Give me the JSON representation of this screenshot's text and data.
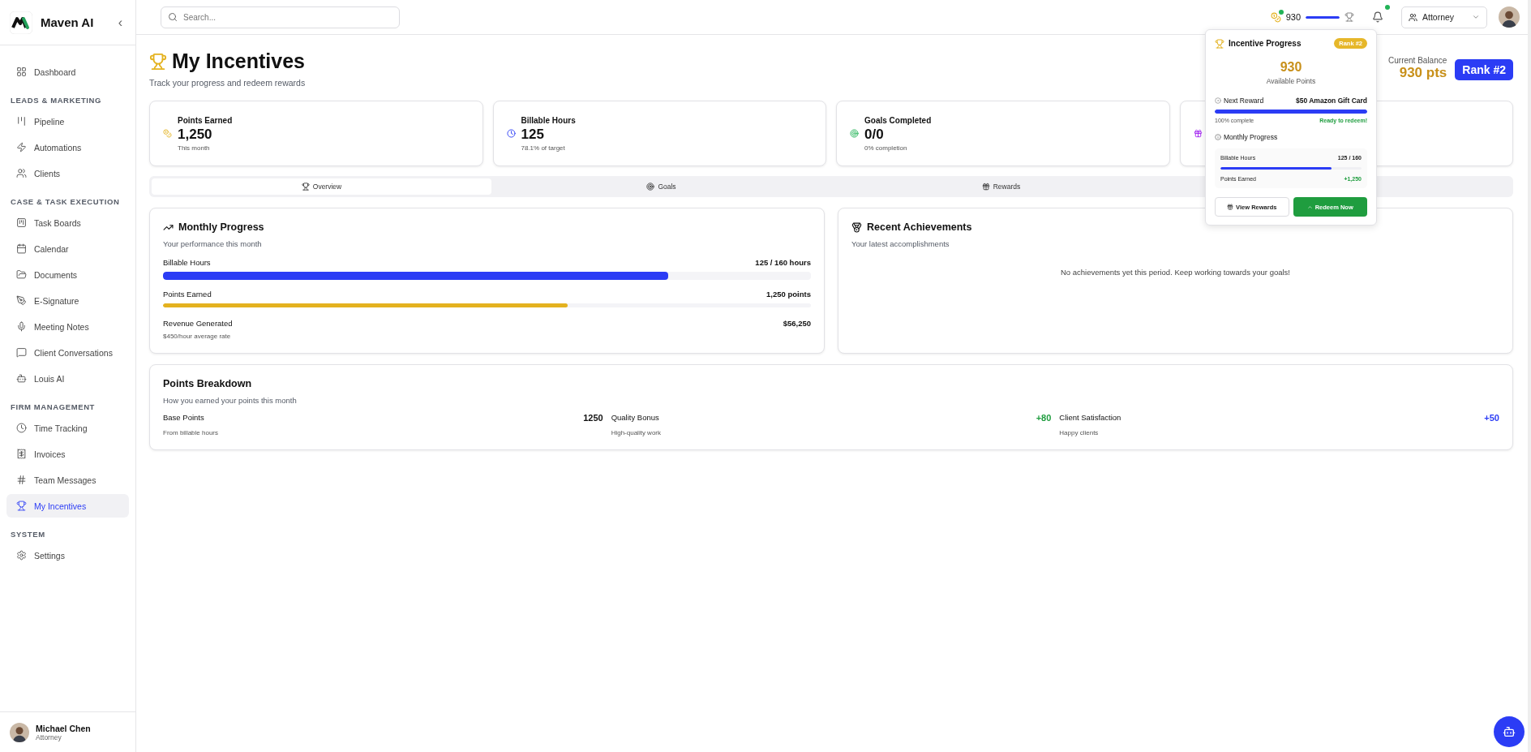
{
  "sidebar": {
    "brand": "Maven AI",
    "collapse": "‹",
    "sections": [
      {
        "items": [
          {
            "label": "Dashboard",
            "selected": false
          }
        ]
      },
      {
        "title": "LEADS & MARKETING",
        "items": [
          {
            "label": "Pipeline",
            "selected": false
          },
          {
            "label": "Automations",
            "selected": false
          },
          {
            "label": "Clients",
            "selected": false
          }
        ]
      },
      {
        "title": "CASE & TASK EXECUTION",
        "items": [
          {
            "label": "Task Boards",
            "selected": false
          },
          {
            "label": "Calendar",
            "selected": false
          },
          {
            "label": "Documents",
            "selected": false
          },
          {
            "label": "E-Signature",
            "selected": false
          },
          {
            "label": "Meeting Notes",
            "selected": false
          },
          {
            "label": "Client Conversations",
            "selected": false
          },
          {
            "label": "Louis AI",
            "selected": false
          }
        ]
      },
      {
        "title": "FIRM MANAGEMENT",
        "items": [
          {
            "label": "Time Tracking",
            "selected": false
          },
          {
            "label": "Invoices",
            "selected": false
          },
          {
            "label": "Team Messages",
            "selected": false
          },
          {
            "label": "My Incentives",
            "selected": true
          }
        ]
      },
      {
        "title": "SYSTEM",
        "items": [
          {
            "label": "Settings",
            "selected": false
          }
        ]
      }
    ],
    "user": {
      "name": "Michael Chen",
      "role": "Attorney"
    }
  },
  "topbar": {
    "search": {
      "placeholder": "Search..."
    },
    "points": "930",
    "points_bar": {
      "level": 1
    },
    "role": "Attorney"
  },
  "header": {
    "title": "My Incentives",
    "subtitle": "Track your progress and redeem rewards",
    "balance_label": "Current Balance",
    "balance": "930 pts",
    "rank": "Rank #2"
  },
  "stats": [
    {
      "kind": "points",
      "title": "Points Earned",
      "value": "1,250",
      "sub": "This month"
    },
    {
      "kind": "hours",
      "title": "Billable Hours",
      "value": "125",
      "sub": "78.1% of target"
    },
    {
      "kind": "goals",
      "title": "Goals Completed",
      "value": "0/0",
      "sub": "0% completion"
    },
    {
      "kind": "rewards"
    }
  ],
  "tabs": [
    {
      "kind": "overview",
      "label": "Overview",
      "selected": true
    },
    {
      "kind": "goals",
      "label": "Goals",
      "selected": false
    },
    {
      "kind": "rewards",
      "label": "Rewards",
      "selected": false
    }
  ],
  "monthly": {
    "title": "Monthly Progress",
    "subtitle": "Your performance this month",
    "rows": [
      {
        "kind": "bar",
        "label": "Billable Hours",
        "value": "125 / 160 hours",
        "level": 0.78,
        "color": "#2b3cf5"
      },
      {
        "kind": "bar",
        "label": "Points Earned",
        "value": "1,250 points",
        "level": 0.625,
        "color": "#e4b21f"
      },
      {
        "kind": "note",
        "label": "Revenue Generated",
        "value": "$56,250",
        "note": "$450/hour average rate"
      }
    ]
  },
  "achievements": {
    "title": "Recent Achievements",
    "subtitle": "Your latest accomplishments",
    "empty": "No achievements yet this period. Keep working towards your goals!"
  },
  "breakdown": {
    "title": "Points Breakdown",
    "subtitle": "How you earned your points this month",
    "items": [
      {
        "label": "Base Points",
        "note": "From billable hours",
        "value": "1250",
        "color": "#111111"
      },
      {
        "label": "Quality Bonus",
        "note": "High-quality work",
        "value": "+80",
        "color": "#1f9d3f"
      },
      {
        "label": "Client Satisfaction",
        "note": "Happy clients",
        "value": "+50",
        "color": "#2b3cf5"
      }
    ]
  },
  "popup": {
    "title": "Incentive Progress",
    "badge": "Rank #2",
    "points": "930",
    "points_label": "Available Points",
    "next_label": "Next Reward",
    "next_value": "$50 Amazon Gift Card",
    "next_bar": {
      "level": 1
    },
    "complete": "100% complete",
    "ready": "Ready to redeem!",
    "monthly_label": "Monthly Progress",
    "hours_label": "Billable Hours",
    "hours_value": "125 / 160",
    "hours_bar": {
      "level": 0.785
    },
    "earned_label": "Points Earned",
    "earned_value": "+1,250",
    "buttons": [
      {
        "kind": "secondary",
        "label": "View Rewards"
      },
      {
        "kind": "primary",
        "label": "Redeem Now"
      }
    ]
  }
}
